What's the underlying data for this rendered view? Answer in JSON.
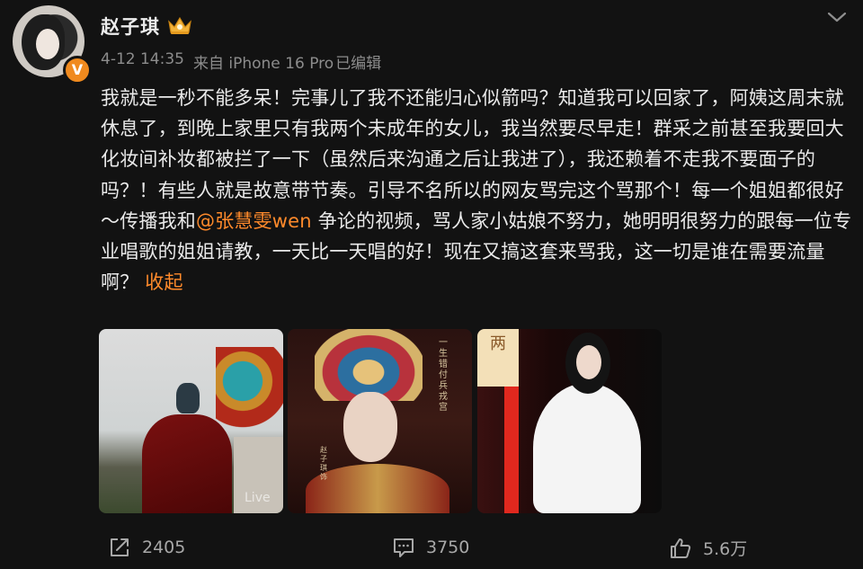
{
  "author": {
    "name": "赵子琪",
    "verified_badge": "V"
  },
  "meta": {
    "date": "4-12 14:35",
    "source": "来自 iPhone 16 Pro",
    "edited": "已编辑"
  },
  "post": {
    "text_before_mention": "我就是一秒不能多呆！完事儿了我不还能归心似箭吗？知道我可以回家了，阿姨这周末就休息了，到晚上家里只有我两个未成年的女儿，我当然要尽早走！群采之前甚至我要回大化妆间补妆都被拦了一下（虽然后来沟通之后让我进了），我还赖着不走我不要面子的吗？！有些人就是故意带节奏。引导不名所以的网友骂完这个骂那个！每一个姐姐都很好～传播我和",
    "mention": "@张慧雯wen",
    "text_after_mention": " 争论的视频，骂人家小姑娘不努力，她明明很努力的跟每一位专业唱歌的姐姐请教，一天比一天唱的好！现在又搞这套来骂我，这一切是谁在需要流量啊？",
    "collapse_label": "收起"
  },
  "photos": {
    "live_label": "Live",
    "poster_text_right": "一生错付兵戎宫",
    "poster_text_left": "赵子琪 饰",
    "stage_sign": "两"
  },
  "actions": {
    "repost_count": "2405",
    "comment_count": "3750",
    "like_count": "5.6万"
  },
  "colors": {
    "background": "#121212",
    "accent": "#ff8a2b",
    "verified": "#f08a1e"
  }
}
